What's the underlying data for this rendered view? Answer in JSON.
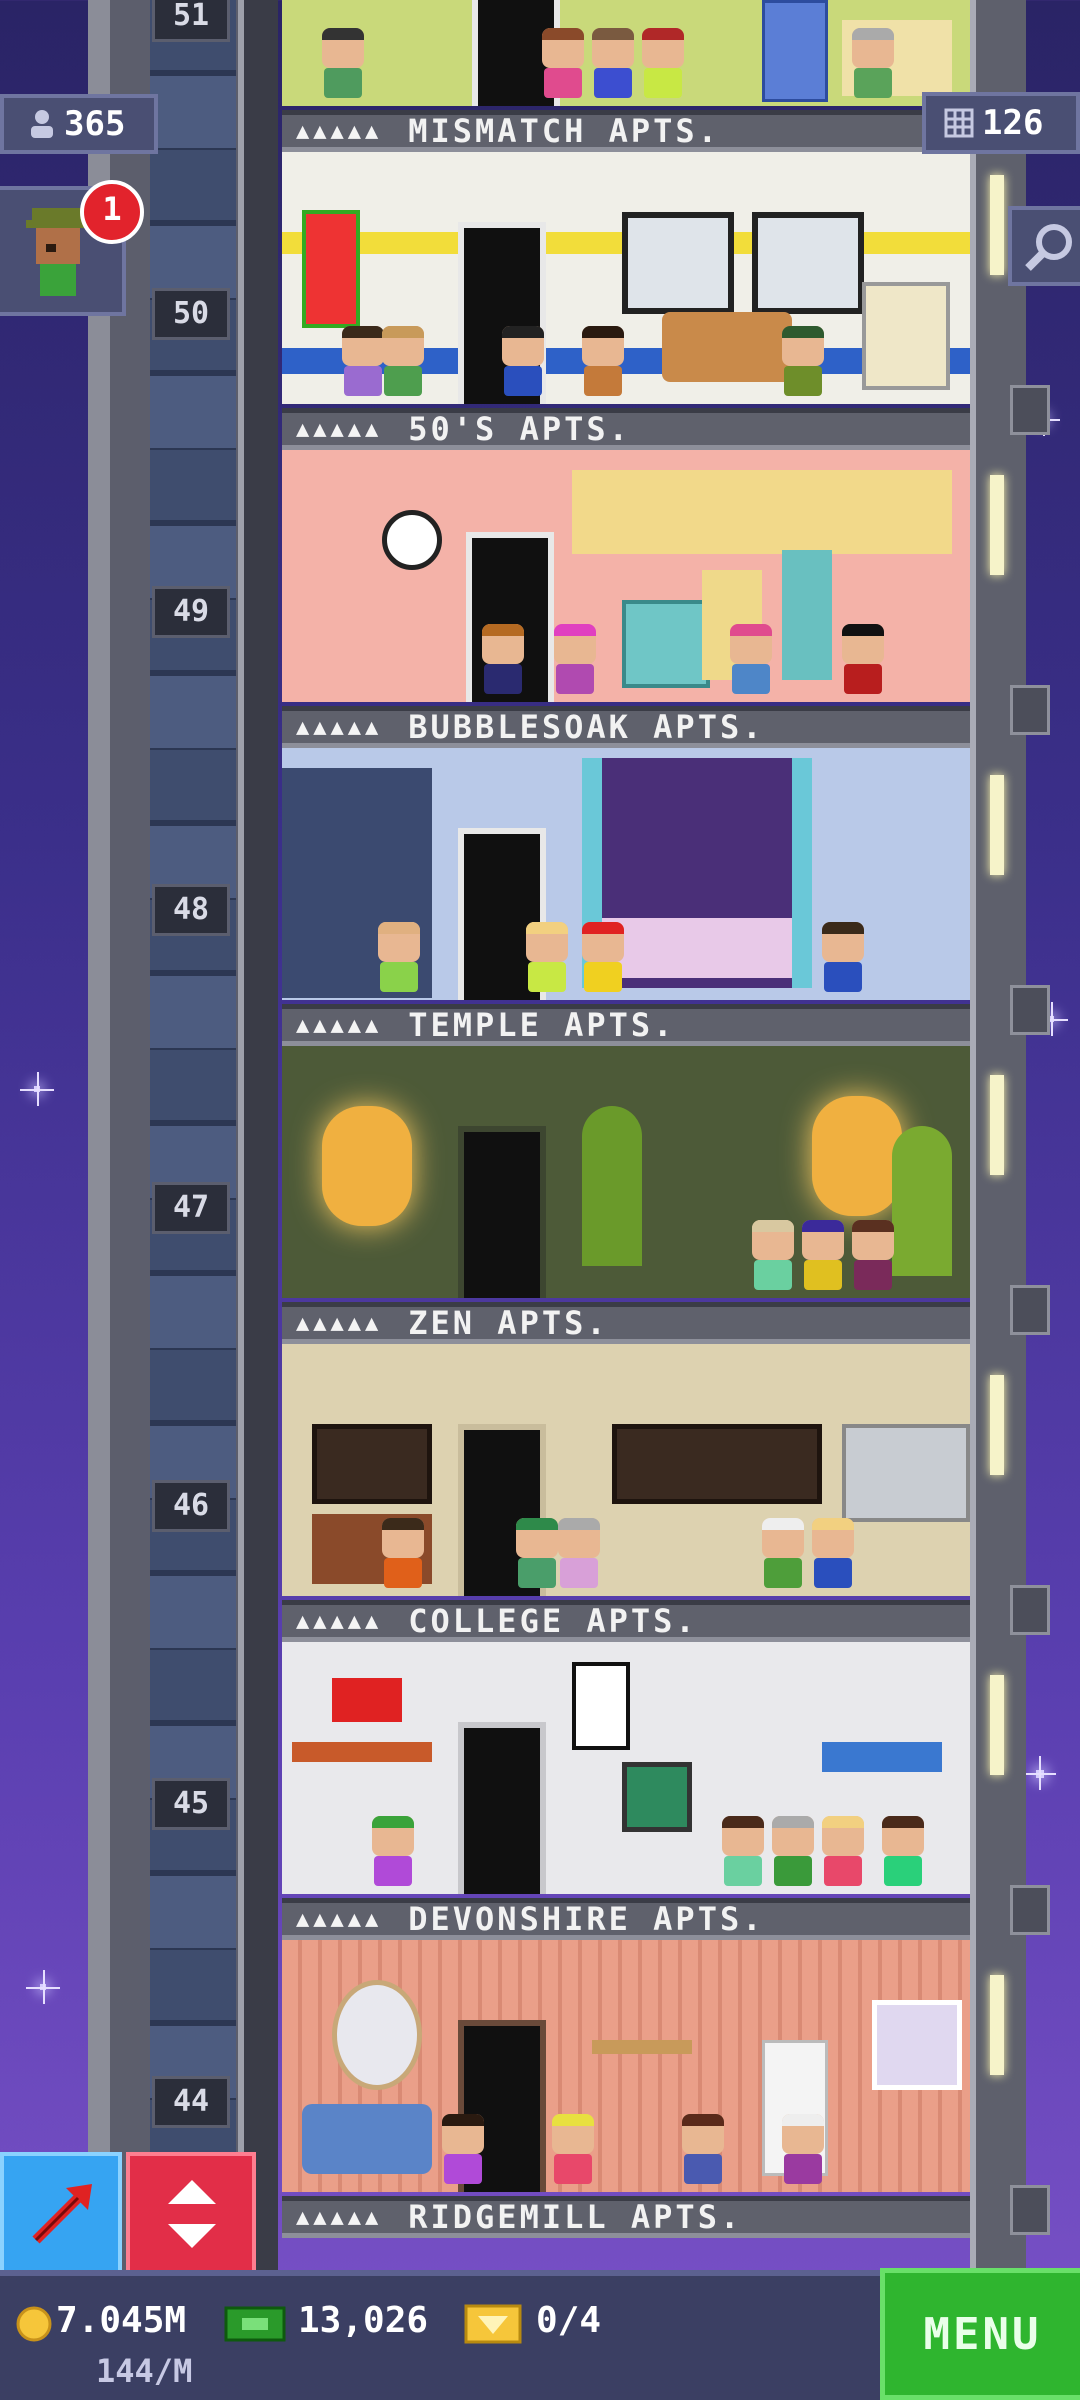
{
  "hud": {
    "population": "365",
    "population_icon": "person-icon",
    "floors_count": "126",
    "floors_icon": "building-grid-icon",
    "notification_count": "1",
    "search_icon": "magnifier-icon"
  },
  "floor_numbers": [
    "51",
    "50",
    "49",
    "48",
    "47",
    "46",
    "45",
    "44"
  ],
  "floors": [
    {
      "name": "MISMATCH APTS.",
      "stars": "▲▲▲▲▲",
      "color": "#c9d97a"
    },
    {
      "name": "50'S APTS.",
      "stars": "▲▲▲▲▲",
      "color": "#f0efe8"
    },
    {
      "name": "BUBBLESOAK APTS.",
      "stars": "▲▲▲▲▲",
      "color": "#f4b2a8"
    },
    {
      "name": "TEMPLE APTS.",
      "stars": "▲▲▲▲▲",
      "color": "#b9c9e8"
    },
    {
      "name": "ZEN APTS.",
      "stars": "▲▲▲▲▲",
      "color": "#4d5a38"
    },
    {
      "name": "COLLEGE APTS.",
      "stars": "▲▲▲▲▲",
      "color": "#ddd2b0"
    },
    {
      "name": "DEVONSHIRE APTS.",
      "stars": "▲▲▲▲▲",
      "color": "#e9e9ec"
    },
    {
      "name": "RIDGEMILL APTS.",
      "stars": "▲▲▲▲▲",
      "color": "#ea9f89"
    }
  ],
  "bottom": {
    "coins": "7.045M",
    "coins_rate": "144/M",
    "bux": "13,026",
    "tickets": "0/4",
    "menu_label": "MENU"
  }
}
